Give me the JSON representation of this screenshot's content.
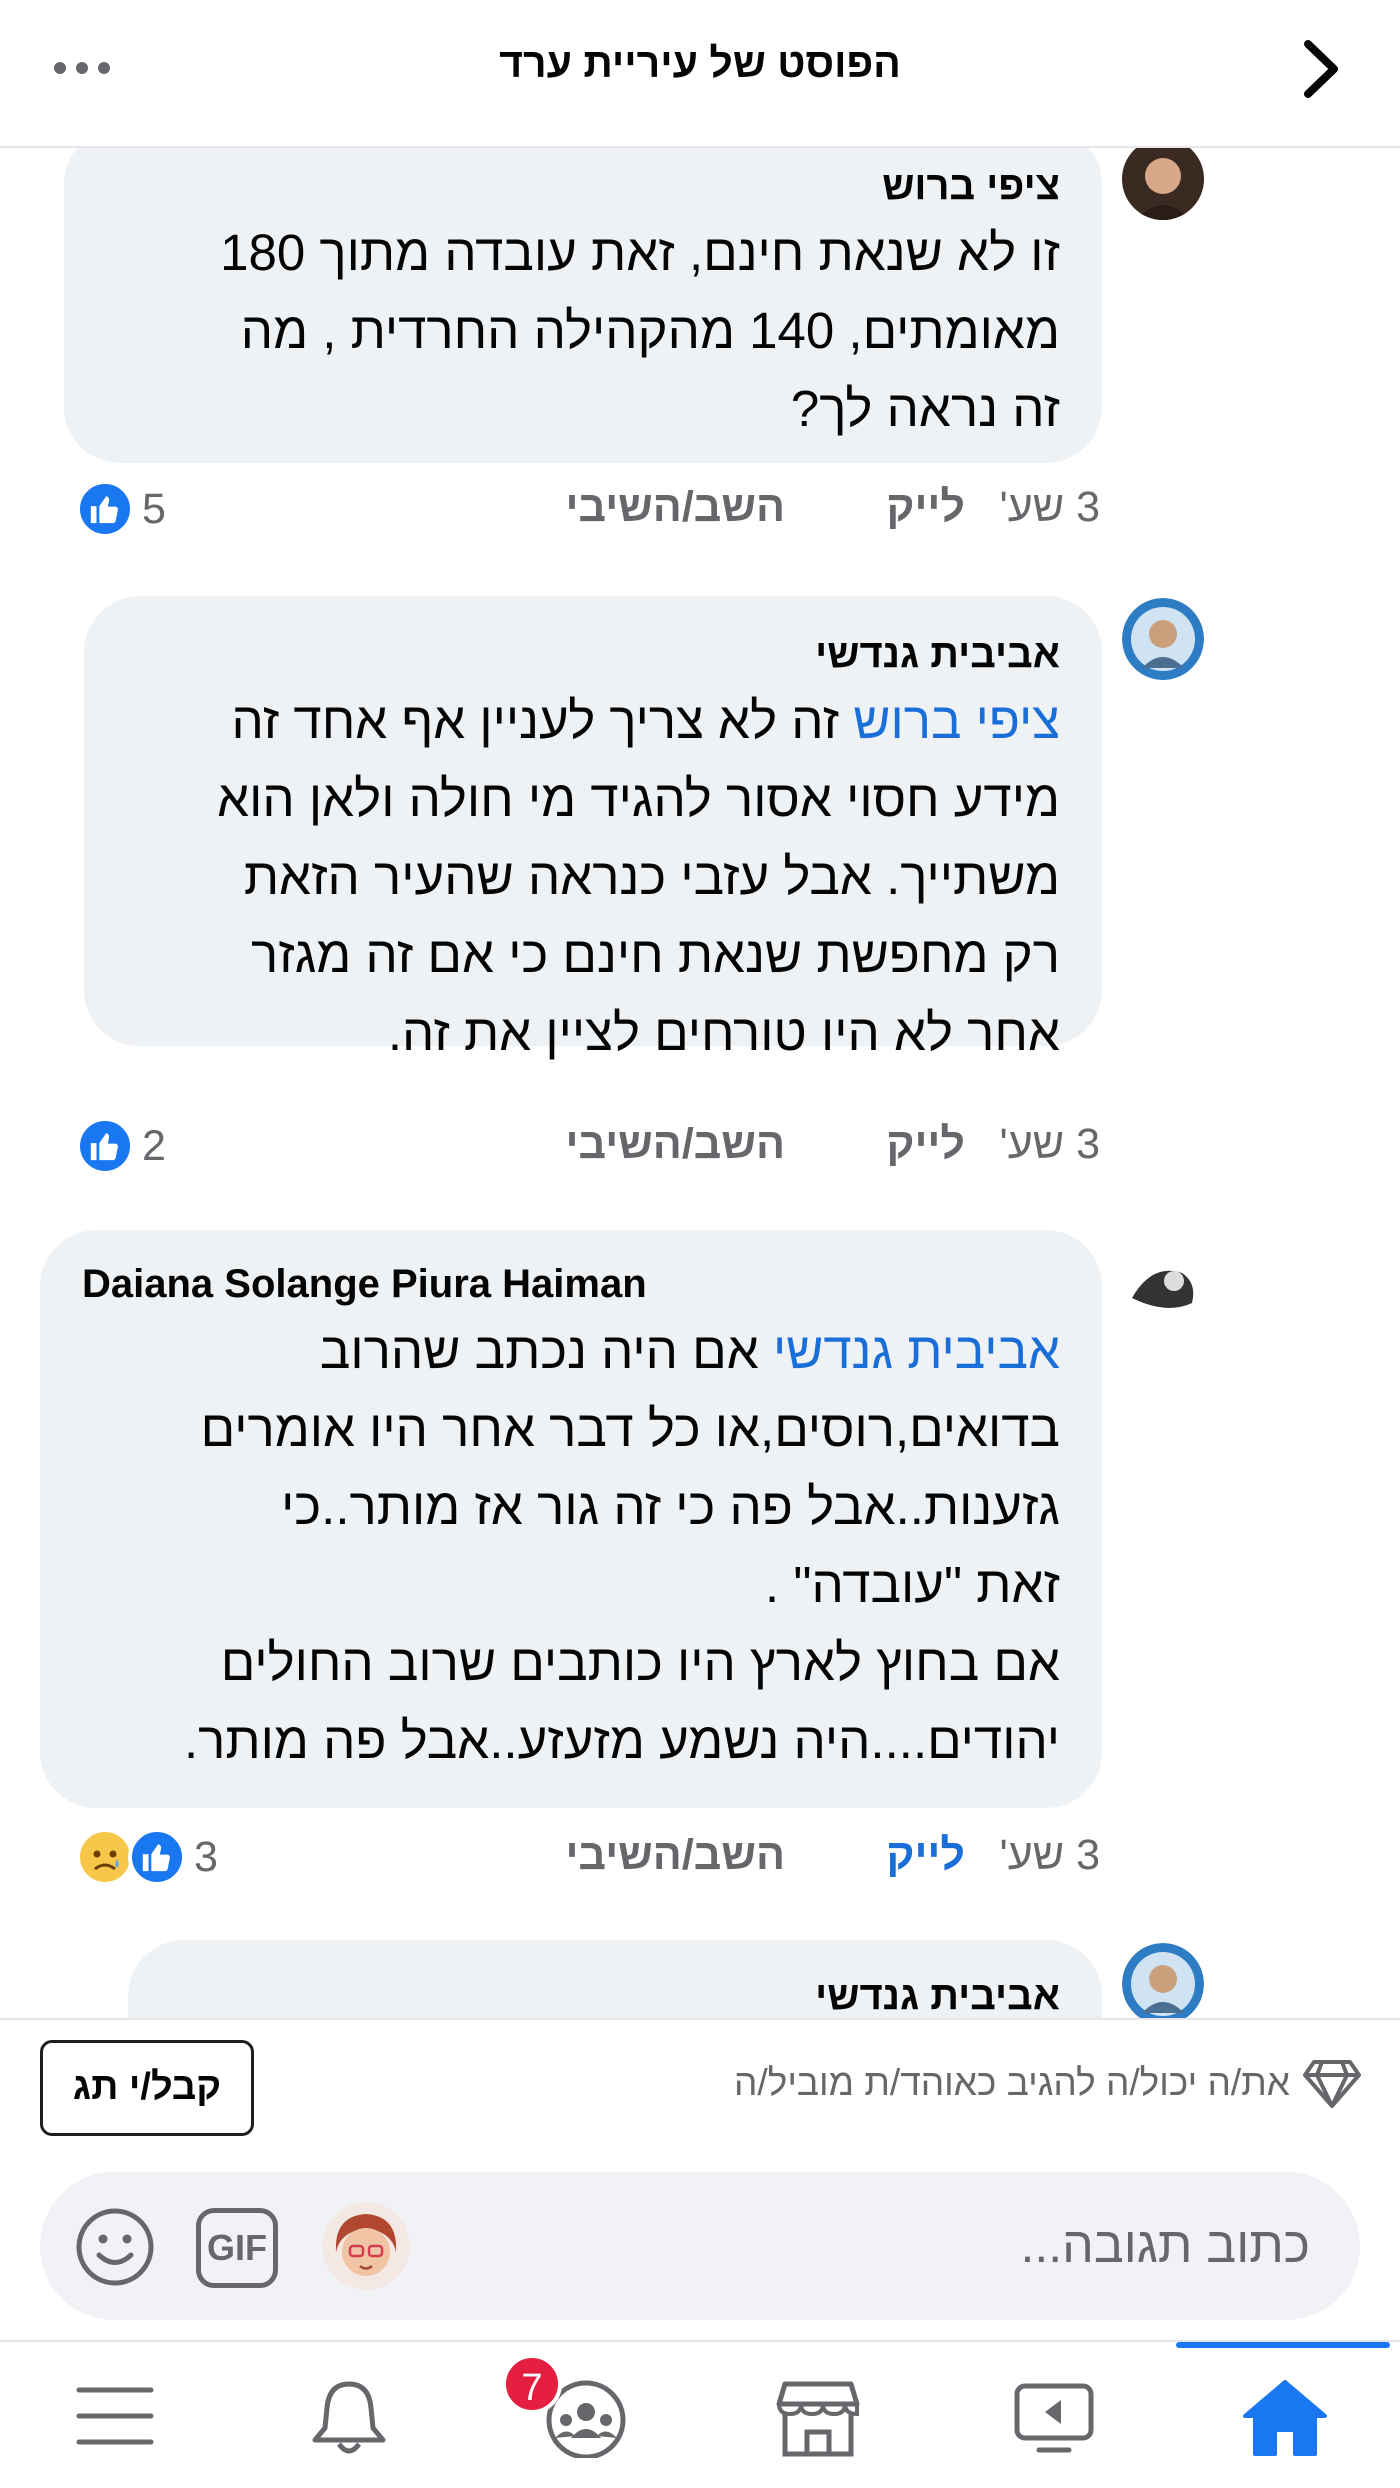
{
  "header": {
    "title": "הפוסט של עיריית ערד"
  },
  "comments": [
    {
      "author": "ציפי ברוש",
      "mention": "",
      "lines": [
        "זו לא שנאת חינם, זאת  עובדה מתוך 180",
        "מאומתים,  140 מהקהילה החרדית , מה",
        "זה נראה לך?"
      ],
      "time": "3 שע'",
      "like_label": "לייק",
      "reply_label": "השב/השיבי",
      "reaction_count": "5",
      "reactions": [
        "like"
      ]
    },
    {
      "author": "אביבית גנדשי",
      "mention": "ציפי ברוש",
      "lines": [
        "זה לא צריך לעניין אף אחד זה",
        "מידע חסוי אסור  להגיד מי חולה ולאן הוא",
        "משתייך. אבל עזבי כנראה שהעיר הזאת",
        "רק מחפשת שנאת חינם כי אם זה מגזר",
        "אחר לא היו טורחים לציין את זה."
      ],
      "time": "3 שע'",
      "like_label": "לייק",
      "reply_label": "השב/השיבי",
      "reaction_count": "2",
      "reactions": [
        "like"
      ]
    },
    {
      "author": "Daiana Solange Piura Haiman",
      "mention": "אביבית גנדשי",
      "lines": [
        "אם היה נכתב שהרוב",
        "בדואים,רוסים,או כל דבר אחר היו אומרים",
        "גזענות..אבל פה כי זה גור אז מותר..כי",
        "זאת \"עובדה\" .",
        "אם בחוץ לארץ היו כותבים שרוב החולים",
        "יהודים....היה נשמע מזעזע..אבל פה מותר."
      ],
      "time": "3 שע'",
      "like_label": "לייק",
      "reply_label": "השב/השיבי",
      "reaction_count": "3",
      "reactions": [
        "like",
        "sad"
      ]
    },
    {
      "author": "אביבית גנדשי"
    }
  ],
  "badge_bar": {
    "button_label": "קבל/י תג",
    "text": "את/ה יכול/ה להגיב כאוהד/ת מוביל/ה",
    "icon": "diamond-icon"
  },
  "composer": {
    "placeholder": "כתוב תגובה...",
    "gif_label": "GIF"
  },
  "tabbar": {
    "tabs": [
      "menu",
      "notifications",
      "groups",
      "marketplace",
      "watch",
      "home"
    ],
    "active_tab": "home",
    "groups_badge": "7"
  },
  "colors": {
    "accent": "#1a77f2",
    "mention": "#1a6ed8",
    "bubble": "#eff2f5",
    "badge": "#e41e3f"
  }
}
